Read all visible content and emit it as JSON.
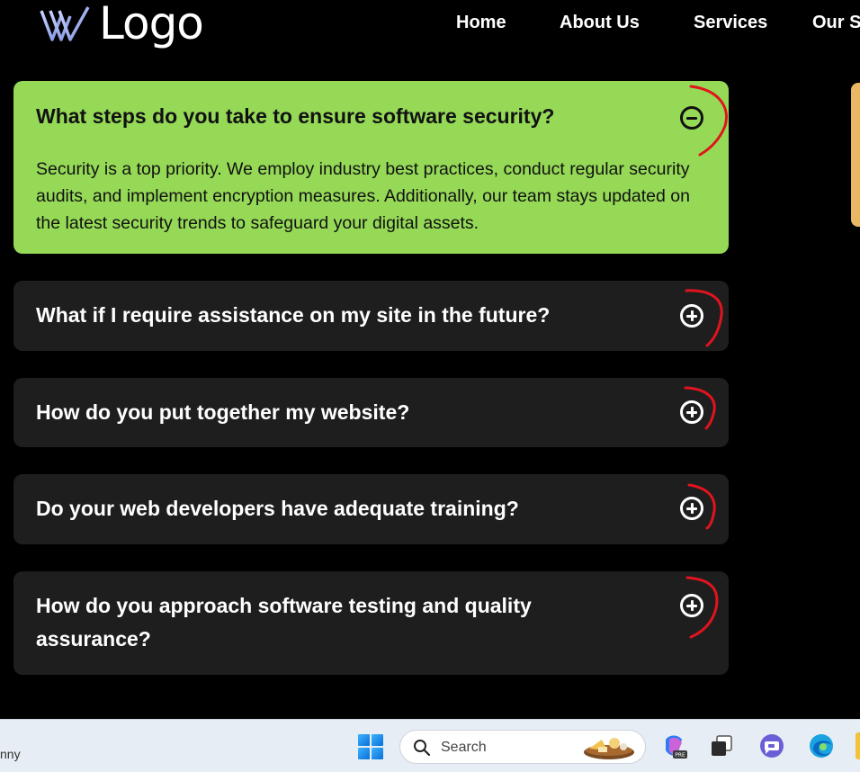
{
  "header": {
    "logo_text": "Logo",
    "nav": [
      "Home",
      "About Us",
      "Services",
      "Our S"
    ]
  },
  "faqs": [
    {
      "question": "What steps do you take to ensure software security?",
      "answer": "Security is a top priority. We employ industry best practices, conduct regular security audits, and implement encryption measures. Additionally, our team stays updated on the latest security trends to safeguard your digital assets.",
      "expanded": true,
      "toggle_icon": "minus-circle-icon"
    },
    {
      "question": "What if I require assistance on my site in the future?",
      "expanded": false,
      "toggle_icon": "plus-circle-icon"
    },
    {
      "question": "How do you put together my website?",
      "expanded": false,
      "toggle_icon": "plus-circle-icon"
    },
    {
      "question": "Do your web developers have adequate training?",
      "expanded": false,
      "toggle_icon": "plus-circle-icon"
    },
    {
      "question": "How do you approach software testing and quality assurance?",
      "expanded": false,
      "toggle_icon": "plus-circle-icon"
    }
  ],
  "colors": {
    "background": "#000000",
    "expanded_card": "#95d957",
    "collapsed_card": "#1e1e1f",
    "annotation": "#e0141e"
  },
  "taskbar": {
    "left_text": "nny",
    "search_placeholder": "Search",
    "icons": [
      "windows-start-icon",
      "search-icon",
      "copilot-icon",
      "task-view-icon",
      "teams-icon",
      "edge-icon"
    ]
  }
}
